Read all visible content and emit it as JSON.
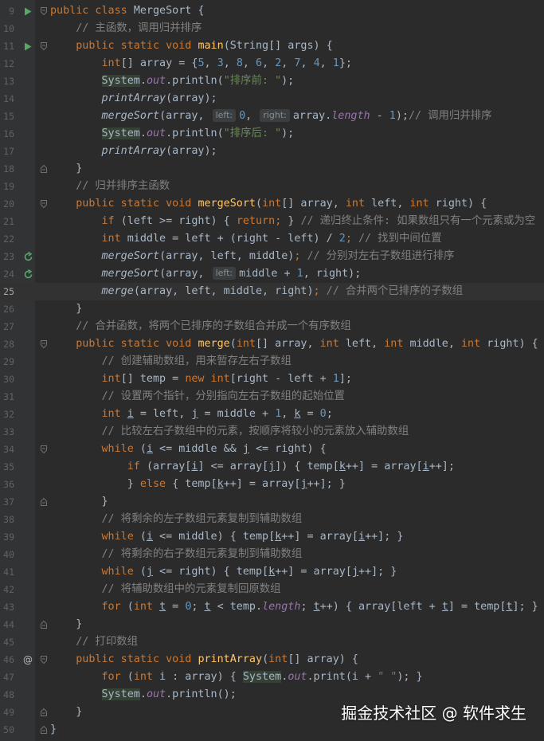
{
  "colors": {
    "background": "#2b2b2b",
    "keyword": "#cc7832",
    "function": "#ffc66d",
    "number": "#6897bb",
    "string": "#6a8759",
    "comment": "#808080",
    "field": "#9876aa",
    "plain": "#a9b7c6"
  },
  "watermark": "掘金技术社区 @ 软件求生",
  "current_line": 25,
  "lines": [
    {
      "n": "9",
      "icon": "run",
      "fold": "open",
      "tokens": [
        [
          "kw",
          "public class "
        ],
        [
          "",
          "MergeSort {"
        ]
      ]
    },
    {
      "n": "10",
      "tokens": [
        [
          "cm",
          "    // 主函数，调用归并排序"
        ]
      ]
    },
    {
      "n": "11",
      "icon": "run",
      "fold": "open",
      "tokens": [
        [
          "kw",
          "    public static void "
        ],
        [
          "fn",
          "main"
        ],
        [
          "",
          "(String[] args) {"
        ]
      ]
    },
    {
      "n": "12",
      "tokens": [
        [
          "kw",
          "        int"
        ],
        [
          "",
          "[] array = {"
        ],
        [
          "num",
          "5"
        ],
        [
          "",
          ", "
        ],
        [
          "num",
          "3"
        ],
        [
          "",
          ", "
        ],
        [
          "num",
          "8"
        ],
        [
          "",
          ", "
        ],
        [
          "num",
          "6"
        ],
        [
          "",
          ", "
        ],
        [
          "num",
          "2"
        ],
        [
          "",
          ", "
        ],
        [
          "num",
          "7"
        ],
        [
          "",
          ", "
        ],
        [
          "num",
          "4"
        ],
        [
          "",
          ", "
        ],
        [
          "num",
          "1"
        ],
        [
          "",
          "};"
        ]
      ]
    },
    {
      "n": "13",
      "tokens": [
        [
          "",
          "        "
        ],
        [
          "cls",
          "System"
        ],
        [
          "",
          "."
        ],
        [
          "fld",
          "out"
        ],
        [
          "",
          ".println("
        ],
        [
          "str",
          "\"排序前: \""
        ],
        [
          "",
          ");"
        ]
      ]
    },
    {
      "n": "14",
      "tokens": [
        [
          "ital",
          "        printArray"
        ],
        [
          "",
          "(array);"
        ]
      ]
    },
    {
      "n": "15",
      "tokens": [
        [
          "ital",
          "        mergeSort"
        ],
        [
          "",
          "(array, "
        ],
        [
          "hint",
          "left:"
        ],
        [
          "num",
          "0"
        ],
        [
          "",
          ", "
        ],
        [
          "hint",
          "right:"
        ],
        [
          "",
          "array."
        ],
        [
          "fld",
          "length"
        ],
        [
          "",
          " - "
        ],
        [
          "num",
          "1"
        ],
        [
          "",
          ");"
        ],
        [
          "cm",
          "// 调用归并排序"
        ]
      ]
    },
    {
      "n": "16",
      "tokens": [
        [
          "",
          "        "
        ],
        [
          "cls",
          "System"
        ],
        [
          "",
          "."
        ],
        [
          "fld",
          "out"
        ],
        [
          "",
          ".println("
        ],
        [
          "str",
          "\"排序后: \""
        ],
        [
          "",
          ");"
        ]
      ]
    },
    {
      "n": "17",
      "tokens": [
        [
          "ital",
          "        printArray"
        ],
        [
          "",
          "(array);"
        ]
      ]
    },
    {
      "n": "18",
      "fold": "close",
      "tokens": [
        [
          "",
          "    }"
        ]
      ]
    },
    {
      "n": "19",
      "tokens": [
        [
          "cm",
          "    // 归并排序主函数"
        ]
      ]
    },
    {
      "n": "20",
      "fold": "open",
      "tokens": [
        [
          "kw",
          "    public static void "
        ],
        [
          "fn",
          "mergeSort"
        ],
        [
          "",
          "("
        ],
        [
          "kw",
          "int"
        ],
        [
          "",
          "[] array, "
        ],
        [
          "kw",
          "int "
        ],
        [
          "",
          "left, "
        ],
        [
          "kw",
          "int "
        ],
        [
          "",
          "right) {"
        ]
      ]
    },
    {
      "n": "21",
      "tokens": [
        [
          "kw",
          "        if "
        ],
        [
          "",
          "(left >= right) { "
        ],
        [
          "kw",
          "return"
        ],
        [
          "kw",
          "; "
        ],
        [
          "",
          "} "
        ],
        [
          "cm",
          "// 递归终止条件: 如果数组只有一个元素或为空"
        ]
      ]
    },
    {
      "n": "22",
      "tokens": [
        [
          "kw",
          "        int "
        ],
        [
          "",
          "middle = left + (right - left) / "
        ],
        [
          "num",
          "2"
        ],
        [
          "kw",
          "; "
        ],
        [
          "cm",
          "// 找到中间位置"
        ]
      ]
    },
    {
      "n": "23",
      "icon": "recursive",
      "tokens": [
        [
          "ital",
          "        mergeSort"
        ],
        [
          "",
          "(array, left, middle)"
        ],
        [
          "kw",
          "; "
        ],
        [
          "cm",
          "// 分别对左右子数组进行排序"
        ]
      ]
    },
    {
      "n": "24",
      "icon": "recursive",
      "tokens": [
        [
          "ital",
          "        mergeSort"
        ],
        [
          "",
          "(array, "
        ],
        [
          "hint",
          "left:"
        ],
        [
          "",
          "middle + "
        ],
        [
          "num",
          "1"
        ],
        [
          "",
          ", right);"
        ]
      ]
    },
    {
      "n": "25",
      "tokens": [
        [
          "ital",
          "        merge"
        ],
        [
          "",
          "(array, left, middle, right)"
        ],
        [
          "kw",
          "; "
        ],
        [
          "cm",
          "// 合并两个已排序的子数组"
        ]
      ]
    },
    {
      "n": "26",
      "tokens": [
        [
          "",
          "    }"
        ]
      ]
    },
    {
      "n": "27",
      "tokens": [
        [
          "cm",
          "    // 合并函数，将两个已排序的子数组合并成一个有序数组"
        ]
      ]
    },
    {
      "n": "28",
      "fold": "open",
      "tokens": [
        [
          "kw",
          "    public static void "
        ],
        [
          "fn",
          "merge"
        ],
        [
          "",
          "("
        ],
        [
          "kw",
          "int"
        ],
        [
          "",
          "[] array, "
        ],
        [
          "kw",
          "int "
        ],
        [
          "",
          "left, "
        ],
        [
          "kw",
          "int "
        ],
        [
          "",
          "middle, "
        ],
        [
          "kw",
          "int "
        ],
        [
          "",
          "right) {"
        ]
      ]
    },
    {
      "n": "29",
      "tokens": [
        [
          "cm",
          "        // 创建辅助数组，用来暂存左右子数组"
        ]
      ]
    },
    {
      "n": "30",
      "tokens": [
        [
          "kw",
          "        int"
        ],
        [
          "",
          "[] temp = "
        ],
        [
          "kw",
          "new int"
        ],
        [
          "",
          "[right - left + "
        ],
        [
          "num",
          "1"
        ],
        [
          "",
          "];"
        ]
      ]
    },
    {
      "n": "31",
      "tokens": [
        [
          "cm",
          "        // 设置两个指针，分别指向左右子数组的起始位置"
        ]
      ]
    },
    {
      "n": "32",
      "tokens": [
        [
          "kw",
          "        int "
        ],
        [
          "ul",
          "i"
        ],
        [
          "",
          " = left, "
        ],
        [
          "ul",
          "j"
        ],
        [
          "",
          " = middle + "
        ],
        [
          "num",
          "1"
        ],
        [
          "",
          ", "
        ],
        [
          "ul",
          "k"
        ],
        [
          "",
          " = "
        ],
        [
          "num",
          "0"
        ],
        [
          "",
          ";"
        ]
      ]
    },
    {
      "n": "33",
      "tokens": [
        [
          "cm",
          "        // 比较左右子数组中的元素，按顺序将较小的元素放入辅助数组"
        ]
      ]
    },
    {
      "n": "34",
      "fold": "open",
      "tokens": [
        [
          "kw",
          "        while "
        ],
        [
          "",
          "("
        ],
        [
          "ul",
          "i"
        ],
        [
          "",
          " <= middle && "
        ],
        [
          "ul",
          "j"
        ],
        [
          "",
          " <= right) {"
        ]
      ]
    },
    {
      "n": "35",
      "tokens": [
        [
          "kw",
          "            if "
        ],
        [
          "",
          "(array["
        ],
        [
          "ul",
          "i"
        ],
        [
          "",
          "] <= array["
        ],
        [
          "ul",
          "j"
        ],
        [
          "",
          "]) { temp["
        ],
        [
          "ul",
          "k"
        ],
        [
          "",
          "++] = array["
        ],
        [
          "ul",
          "i"
        ],
        [
          "",
          "++];"
        ]
      ]
    },
    {
      "n": "36",
      "tokens": [
        [
          "",
          "            } "
        ],
        [
          "kw",
          "else "
        ],
        [
          "",
          "{ temp["
        ],
        [
          "ul",
          "k"
        ],
        [
          "",
          "++] = array["
        ],
        [
          "ul",
          "j"
        ],
        [
          "",
          "++]; }"
        ]
      ]
    },
    {
      "n": "37",
      "fold": "close",
      "tokens": [
        [
          "",
          "        }"
        ]
      ]
    },
    {
      "n": "38",
      "tokens": [
        [
          "cm",
          "        // 将剩余的左子数组元素复制到辅助数组"
        ]
      ]
    },
    {
      "n": "39",
      "tokens": [
        [
          "kw",
          "        while "
        ],
        [
          "",
          "("
        ],
        [
          "ul",
          "i"
        ],
        [
          "",
          " <= middle) { temp["
        ],
        [
          "ul",
          "k"
        ],
        [
          "",
          "++] = array["
        ],
        [
          "ul",
          "i"
        ],
        [
          "",
          "++]; }"
        ]
      ]
    },
    {
      "n": "40",
      "tokens": [
        [
          "cm",
          "        // 将剩余的右子数组元素复制到辅助数组"
        ]
      ]
    },
    {
      "n": "41",
      "tokens": [
        [
          "kw",
          "        while "
        ],
        [
          "",
          "("
        ],
        [
          "ul",
          "j"
        ],
        [
          "",
          " <= right) { temp["
        ],
        [
          "ul",
          "k"
        ],
        [
          "",
          "++] = array["
        ],
        [
          "ul",
          "j"
        ],
        [
          "",
          "++]; }"
        ]
      ]
    },
    {
      "n": "42",
      "tokens": [
        [
          "cm",
          "        // 将辅助数组中的元素复制回原数组"
        ]
      ]
    },
    {
      "n": "43",
      "tokens": [
        [
          "kw",
          "        for "
        ],
        [
          "",
          "("
        ],
        [
          "kw",
          "int "
        ],
        [
          "ul",
          "t"
        ],
        [
          "",
          " = "
        ],
        [
          "num",
          "0"
        ],
        [
          "",
          "; "
        ],
        [
          "ul",
          "t"
        ],
        [
          "",
          " < temp."
        ],
        [
          "fld",
          "length"
        ],
        [
          "",
          "; "
        ],
        [
          "ul",
          "t"
        ],
        [
          "",
          "++) { array[left + "
        ],
        [
          "ul",
          "t"
        ],
        [
          "",
          "] = temp["
        ],
        [
          "ul",
          "t"
        ],
        [
          "",
          "]; }"
        ]
      ]
    },
    {
      "n": "44",
      "fold": "close",
      "tokens": [
        [
          "",
          "    }"
        ]
      ]
    },
    {
      "n": "45",
      "tokens": [
        [
          "cm",
          "    // 打印数组"
        ]
      ]
    },
    {
      "n": "46",
      "icon": "at",
      "fold": "open",
      "tokens": [
        [
          "kw",
          "    public static void "
        ],
        [
          "fn",
          "printArray"
        ],
        [
          "",
          "("
        ],
        [
          "kw",
          "int"
        ],
        [
          "",
          "[] array) {"
        ]
      ]
    },
    {
      "n": "47",
      "tokens": [
        [
          "kw",
          "        for "
        ],
        [
          "",
          "("
        ],
        [
          "kw",
          "int "
        ],
        [
          "",
          "i : array) { "
        ],
        [
          "cls",
          "System"
        ],
        [
          "",
          "."
        ],
        [
          "fld",
          "out"
        ],
        [
          "",
          ".print(i + "
        ],
        [
          "str",
          "\" \""
        ],
        [
          "",
          "); }"
        ]
      ]
    },
    {
      "n": "48",
      "tokens": [
        [
          "",
          "        "
        ],
        [
          "cls",
          "System"
        ],
        [
          "",
          "."
        ],
        [
          "fld",
          "out"
        ],
        [
          "",
          ".println();"
        ]
      ]
    },
    {
      "n": "49",
      "fold": "close",
      "tokens": [
        [
          "",
          "    }"
        ]
      ]
    },
    {
      "n": "50",
      "fold": "close",
      "tokens": [
        [
          "",
          "}"
        ]
      ]
    }
  ]
}
